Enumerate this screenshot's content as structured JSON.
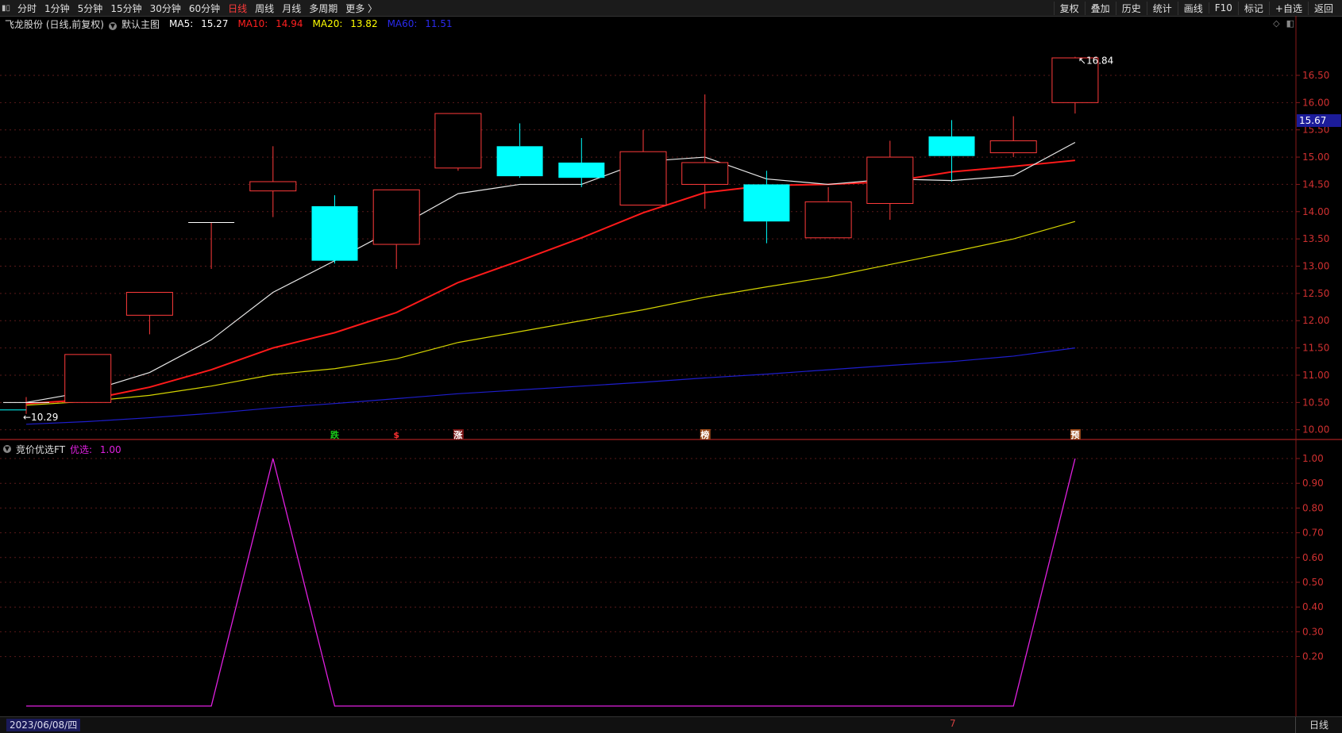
{
  "toolbar": {
    "menu_icon": "menu-icon",
    "periods": [
      "分时",
      "1分钟",
      "5分钟",
      "15分钟",
      "30分钟",
      "60分钟",
      "日线",
      "周线",
      "月线",
      "多周期",
      "更多 〉"
    ],
    "active_period": "日线",
    "right_actions": [
      "复权",
      "叠加",
      "历史",
      "统计",
      "画线",
      "F10",
      "标记",
      "+自选",
      "返回"
    ]
  },
  "main_chart": {
    "title": "飞龙股份 (日线,前复权)",
    "template": "默认主图",
    "ma5": {
      "label": "MA5:",
      "value": "15.27",
      "color": "#ffffff"
    },
    "ma10": {
      "label": "MA10:",
      "value": "14.94",
      "color": "#ff2020"
    },
    "ma20": {
      "label": "MA20:",
      "value": "13.82",
      "color": "#ffff00"
    },
    "ma60": {
      "label": "MA60:",
      "value": "11.51",
      "color": "#1e1ecc"
    },
    "current_price": "15.67",
    "high_label": "16.84",
    "low_label": "10.29",
    "y_ticks": [
      "16.50",
      "16.00",
      "15.50",
      "15.00",
      "14.50",
      "14.00",
      "13.50",
      "13.00",
      "12.50",
      "12.00",
      "11.50",
      "11.00",
      "10.50",
      "10.00"
    ],
    "y_range": [
      9.85,
      17.3
    ],
    "candles": [
      {
        "o": 10.5,
        "c": 10.5,
        "h": 10.6,
        "l": 10.29
      },
      {
        "o": 10.5,
        "c": 11.38,
        "h": 11.38,
        "l": 10.5
      },
      {
        "o": 12.1,
        "c": 12.52,
        "h": 12.52,
        "l": 11.75
      },
      {
        "o": 13.8,
        "c": 13.8,
        "h": 13.8,
        "l": 12.95
      },
      {
        "o": 14.38,
        "c": 14.55,
        "h": 15.2,
        "l": 13.9
      },
      {
        "o": 14.1,
        "c": 13.1,
        "h": 14.3,
        "l": 13.05
      },
      {
        "o": 13.4,
        "c": 14.4,
        "h": 14.4,
        "l": 12.95
      },
      {
        "o": 14.8,
        "c": 15.8,
        "h": 15.8,
        "l": 14.75
      },
      {
        "o": 15.2,
        "c": 14.65,
        "h": 15.62,
        "l": 14.62
      },
      {
        "o": 14.9,
        "c": 14.62,
        "h": 15.35,
        "l": 14.45
      },
      {
        "o": 14.12,
        "c": 15.1,
        "h": 15.5,
        "l": 14.12
      },
      {
        "o": 14.5,
        "c": 14.9,
        "h": 16.15,
        "l": 14.05
      },
      {
        "o": 14.5,
        "c": 13.82,
        "h": 14.75,
        "l": 13.42
      },
      {
        "o": 13.52,
        "c": 14.18,
        "h": 14.45,
        "l": 13.52
      },
      {
        "o": 14.15,
        "c": 15.0,
        "h": 15.3,
        "l": 13.85
      },
      {
        "o": 15.38,
        "c": 15.02,
        "h": 15.68,
        "l": 14.55
      },
      {
        "o": 15.08,
        "c": 15.3,
        "h": 15.75,
        "l": 15.0
      },
      {
        "o": 16.0,
        "c": 16.82,
        "h": 16.84,
        "l": 15.8
      }
    ],
    "ma5_series": [
      10.5,
      10.7,
      11.05,
      11.65,
      12.52,
      13.1,
      13.7,
      14.33,
      14.5,
      14.5,
      14.92,
      15.0,
      14.6,
      14.5,
      14.6,
      14.57,
      14.66,
      15.27
    ],
    "ma10_series": [
      10.48,
      10.55,
      10.78,
      11.1,
      11.5,
      11.78,
      12.15,
      12.7,
      13.1,
      13.52,
      13.98,
      14.35,
      14.48,
      14.5,
      14.55,
      14.73,
      14.83,
      14.94
    ],
    "ma20_series": [
      10.45,
      10.52,
      10.63,
      10.8,
      11.01,
      11.12,
      11.3,
      11.6,
      11.8,
      12.0,
      12.2,
      12.43,
      12.62,
      12.8,
      13.03,
      13.26,
      13.5,
      13.82
    ],
    "ma60_series": [
      10.1,
      10.15,
      10.22,
      10.3,
      10.4,
      10.48,
      10.57,
      10.66,
      10.73,
      10.8,
      10.87,
      10.95,
      11.02,
      11.1,
      11.18,
      11.25,
      11.35,
      11.5
    ],
    "markers": [
      {
        "index": 5,
        "text": "跌",
        "color": "#19c919",
        "bg": "#000"
      },
      {
        "index": 6,
        "text": "$",
        "color": "#ff3030",
        "bg": "#000"
      },
      {
        "index": 7,
        "text": "涨",
        "color": "#ffffff",
        "bg": "#7a1515"
      },
      {
        "index": 11,
        "text": "榜",
        "color": "#ffffff",
        "bg": "#9a4a1a"
      },
      {
        "index": 17,
        "text": "预",
        "color": "#ffffff",
        "bg": "#9a4a1a"
      }
    ]
  },
  "indicator": {
    "name": "竞价优选FT",
    "label": "优选:",
    "value": "1.00",
    "color": "#e020e0",
    "y_ticks": [
      "1.00",
      "0.90",
      "0.80",
      "0.70",
      "0.60",
      "0.50",
      "0.40",
      "0.30",
      "0.20"
    ],
    "series": [
      0,
      0,
      0,
      0,
      1,
      0,
      0,
      0,
      0,
      0,
      0,
      0,
      0,
      0,
      0,
      0,
      0,
      1
    ]
  },
  "bottom": {
    "date": "2023/06/08/四",
    "period_label": "日线",
    "month_mark": "7"
  }
}
